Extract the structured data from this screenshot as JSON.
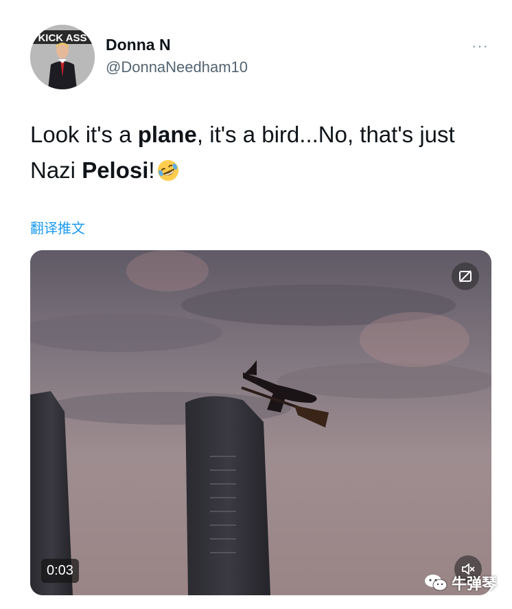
{
  "author": {
    "display_name": "Donna N",
    "handle": "@DonnaNeedham10",
    "avatar_text": "KICK ASS"
  },
  "tweet": {
    "text_part1": "Look it's a ",
    "bold1": "plane",
    "text_part2": ", it's a bird...No, that's just Nazi ",
    "bold2": "Pelosi",
    "text_part3": "!",
    "emoji": "rofl-emoji",
    "translate_label": "翻译推文"
  },
  "media": {
    "duration": "0:03",
    "gif_icon": "no-autoplay-icon",
    "mute_icon": "muted-speaker-icon"
  },
  "watermark": {
    "text": "牛弹琴",
    "icon": "wechat-icon"
  },
  "colors": {
    "link": "#1d9bf0",
    "secondary": "#536471",
    "text": "#0f1419"
  }
}
